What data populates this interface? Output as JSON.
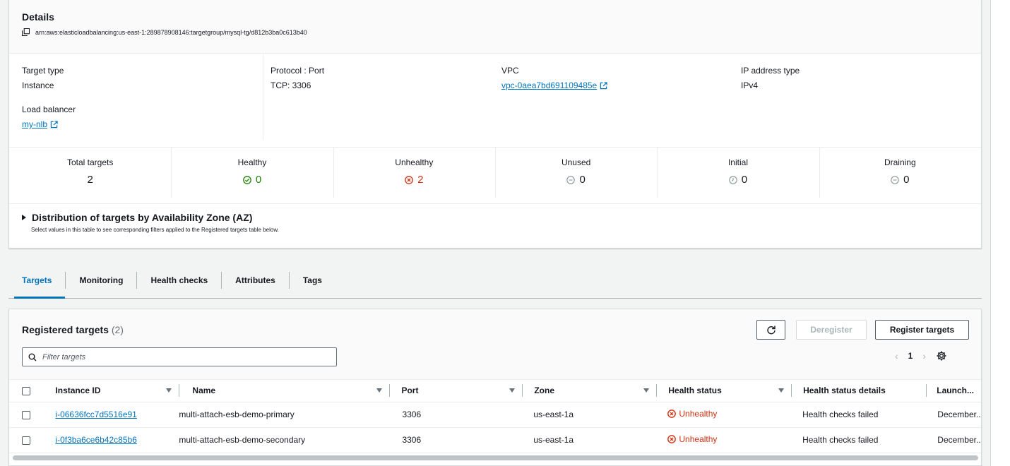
{
  "details": {
    "title": "Details",
    "arn": "arn:aws:elasticloadbalancing:us-east-1:289878908146:targetgroup/mysql-tg/d812b3ba0c613b40",
    "target_type_label": "Target type",
    "target_type_value": "Instance",
    "protocol_label": "Protocol : Port",
    "protocol_value": "TCP: 3306",
    "vpc_label": "VPC",
    "vpc_value": "vpc-0aea7bd691109485e",
    "ip_type_label": "IP address type",
    "ip_type_value": "IPv4",
    "lb_label": "Load balancer",
    "lb_value": "my-nlb"
  },
  "stats": [
    {
      "label": "Total targets",
      "value": "2",
      "color": "#16191f",
      "icon": "none"
    },
    {
      "label": "Healthy",
      "value": "0",
      "color": "#1d8102",
      "icon": "check-circle-icon"
    },
    {
      "label": "Unhealthy",
      "value": "2",
      "color": "#d13212",
      "icon": "x-circle-icon"
    },
    {
      "label": "Unused",
      "value": "0",
      "color": "#16191f",
      "icon": "minus-circle-icon"
    },
    {
      "label": "Initial",
      "value": "0",
      "color": "#16191f",
      "icon": "clock-icon"
    },
    {
      "label": "Draining",
      "value": "0",
      "color": "#16191f",
      "icon": "minus-circle-icon"
    }
  ],
  "distribution": {
    "title": "Distribution of targets by Availability Zone (AZ)",
    "subtitle": "Select values in this table to see corresponding filters applied to the Registered targets table below."
  },
  "tabs": [
    "Targets",
    "Monitoring",
    "Health checks",
    "Attributes",
    "Tags"
  ],
  "registered": {
    "title": "Registered targets",
    "count": "(2)",
    "deregister_label": "Deregister",
    "register_label": "Register targets",
    "search_placeholder": "Filter targets",
    "page": "1",
    "columns": [
      "Instance ID",
      "Name",
      "Port",
      "Zone",
      "Health status",
      "Health status details",
      "Launch..."
    ],
    "rows": [
      {
        "instance_id": "i-06636fcc7d5516e91",
        "name": "multi-attach-esb-demo-primary",
        "port": "3306",
        "zone": "us-east-1a",
        "health": "Unhealthy",
        "details": "Health checks failed",
        "launch": "December..."
      },
      {
        "instance_id": "i-0f3ba6ce6b42c85b6",
        "name": "multi-attach-esb-demo-secondary",
        "port": "3306",
        "zone": "us-east-1a",
        "health": "Unhealthy",
        "details": "Health checks failed",
        "launch": "December..."
      }
    ]
  },
  "colors": {
    "accent": "#0073bb",
    "healthy": "#1d8102",
    "unhealthy": "#d13212"
  }
}
